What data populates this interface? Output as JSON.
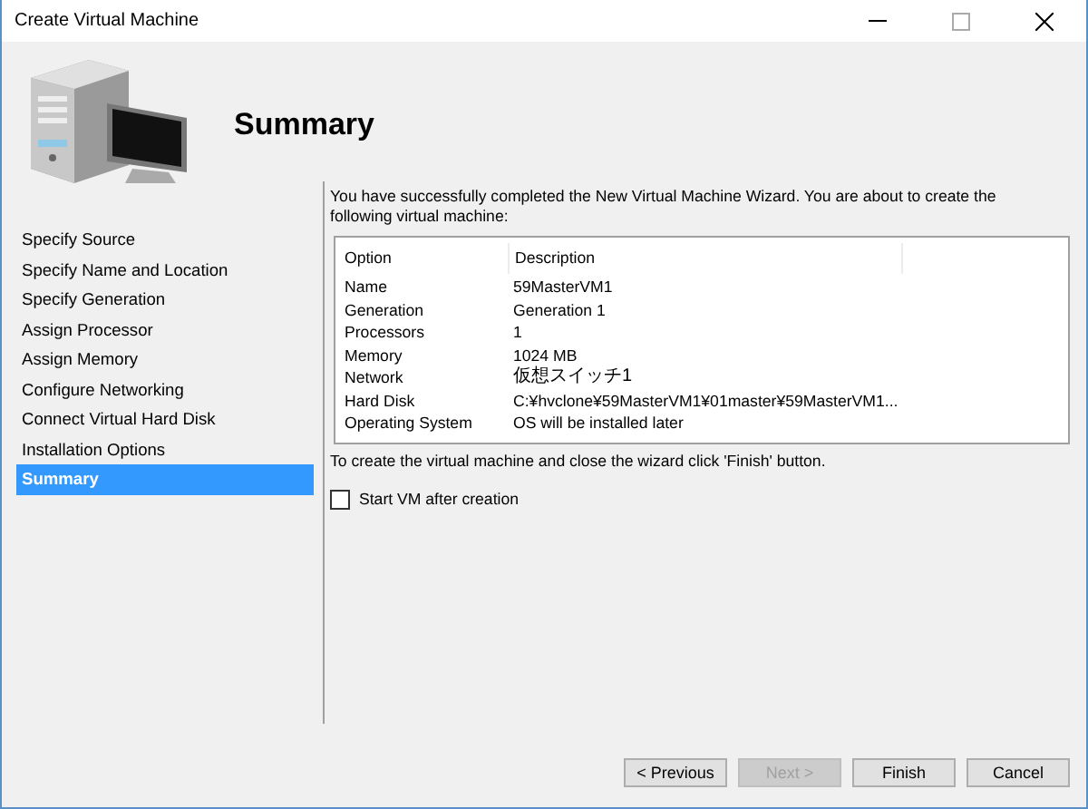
{
  "window": {
    "title": "Create Virtual Machine"
  },
  "page_title": "Summary",
  "steps": [
    {
      "label": "Specify Source",
      "selected": false
    },
    {
      "label": "Specify Name and Location",
      "selected": false
    },
    {
      "label": "Specify Generation",
      "selected": false
    },
    {
      "label": "Assign Processor",
      "selected": false
    },
    {
      "label": "Assign Memory",
      "selected": false
    },
    {
      "label": "Configure Networking",
      "selected": false
    },
    {
      "label": "Connect Virtual Hard Disk",
      "selected": false
    },
    {
      "label": "Installation Options",
      "selected": false
    },
    {
      "label": "Summary",
      "selected": true
    }
  ],
  "intro": "You have successfully completed the New Virtual Machine Wizard. You are about to create the following virtual machine:",
  "table": {
    "columns": [
      "Option",
      "Description"
    ],
    "rows": [
      [
        "Name",
        "59MasterVM1"
      ],
      [
        "Generation",
        "Generation 1"
      ],
      [
        "Processors",
        "1"
      ],
      [
        "Memory",
        "1024 MB"
      ],
      [
        "Network",
        "仮想スイッチ1"
      ],
      [
        "Hard Disk",
        "C:¥hvclone¥59MasterVM1¥01master¥59MasterVM1..."
      ],
      [
        "Operating System",
        "OS will be installed later"
      ]
    ]
  },
  "finish_note": "To create the virtual machine and close the wizard click 'Finish' button.",
  "start_vm": {
    "label": "Start VM after creation",
    "checked": false
  },
  "buttons": [
    {
      "label": "< Previous",
      "disabled": false
    },
    {
      "label": "Next >",
      "disabled": true
    },
    {
      "label": "Finish",
      "disabled": false
    },
    {
      "label": "Cancel",
      "disabled": false
    }
  ]
}
